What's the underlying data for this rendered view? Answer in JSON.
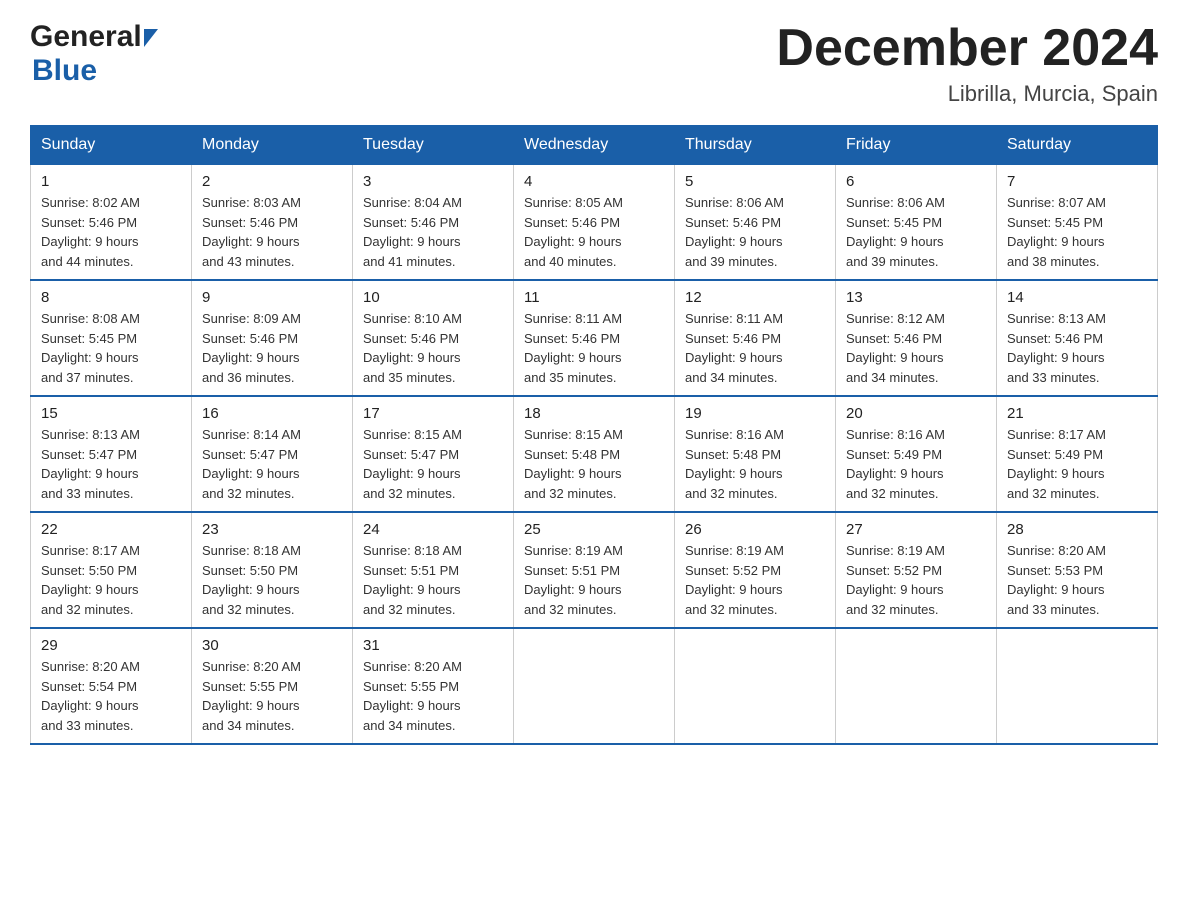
{
  "logo": {
    "general": "General",
    "blue": "Blue"
  },
  "title": "December 2024",
  "subtitle": "Librilla, Murcia, Spain",
  "days_of_week": [
    "Sunday",
    "Monday",
    "Tuesday",
    "Wednesday",
    "Thursday",
    "Friday",
    "Saturday"
  ],
  "weeks": [
    [
      {
        "day": "1",
        "sunrise": "8:02 AM",
        "sunset": "5:46 PM",
        "daylight": "9 hours and 44 minutes."
      },
      {
        "day": "2",
        "sunrise": "8:03 AM",
        "sunset": "5:46 PM",
        "daylight": "9 hours and 43 minutes."
      },
      {
        "day": "3",
        "sunrise": "8:04 AM",
        "sunset": "5:46 PM",
        "daylight": "9 hours and 41 minutes."
      },
      {
        "day": "4",
        "sunrise": "8:05 AM",
        "sunset": "5:46 PM",
        "daylight": "9 hours and 40 minutes."
      },
      {
        "day": "5",
        "sunrise": "8:06 AM",
        "sunset": "5:46 PM",
        "daylight": "9 hours and 39 minutes."
      },
      {
        "day": "6",
        "sunrise": "8:06 AM",
        "sunset": "5:45 PM",
        "daylight": "9 hours and 39 minutes."
      },
      {
        "day": "7",
        "sunrise": "8:07 AM",
        "sunset": "5:45 PM",
        "daylight": "9 hours and 38 minutes."
      }
    ],
    [
      {
        "day": "8",
        "sunrise": "8:08 AM",
        "sunset": "5:45 PM",
        "daylight": "9 hours and 37 minutes."
      },
      {
        "day": "9",
        "sunrise": "8:09 AM",
        "sunset": "5:46 PM",
        "daylight": "9 hours and 36 minutes."
      },
      {
        "day": "10",
        "sunrise": "8:10 AM",
        "sunset": "5:46 PM",
        "daylight": "9 hours and 35 minutes."
      },
      {
        "day": "11",
        "sunrise": "8:11 AM",
        "sunset": "5:46 PM",
        "daylight": "9 hours and 35 minutes."
      },
      {
        "day": "12",
        "sunrise": "8:11 AM",
        "sunset": "5:46 PM",
        "daylight": "9 hours and 34 minutes."
      },
      {
        "day": "13",
        "sunrise": "8:12 AM",
        "sunset": "5:46 PM",
        "daylight": "9 hours and 34 minutes."
      },
      {
        "day": "14",
        "sunrise": "8:13 AM",
        "sunset": "5:46 PM",
        "daylight": "9 hours and 33 minutes."
      }
    ],
    [
      {
        "day": "15",
        "sunrise": "8:13 AM",
        "sunset": "5:47 PM",
        "daylight": "9 hours and 33 minutes."
      },
      {
        "day": "16",
        "sunrise": "8:14 AM",
        "sunset": "5:47 PM",
        "daylight": "9 hours and 32 minutes."
      },
      {
        "day": "17",
        "sunrise": "8:15 AM",
        "sunset": "5:47 PM",
        "daylight": "9 hours and 32 minutes."
      },
      {
        "day": "18",
        "sunrise": "8:15 AM",
        "sunset": "5:48 PM",
        "daylight": "9 hours and 32 minutes."
      },
      {
        "day": "19",
        "sunrise": "8:16 AM",
        "sunset": "5:48 PM",
        "daylight": "9 hours and 32 minutes."
      },
      {
        "day": "20",
        "sunrise": "8:16 AM",
        "sunset": "5:49 PM",
        "daylight": "9 hours and 32 minutes."
      },
      {
        "day": "21",
        "sunrise": "8:17 AM",
        "sunset": "5:49 PM",
        "daylight": "9 hours and 32 minutes."
      }
    ],
    [
      {
        "day": "22",
        "sunrise": "8:17 AM",
        "sunset": "5:50 PM",
        "daylight": "9 hours and 32 minutes."
      },
      {
        "day": "23",
        "sunrise": "8:18 AM",
        "sunset": "5:50 PM",
        "daylight": "9 hours and 32 minutes."
      },
      {
        "day": "24",
        "sunrise": "8:18 AM",
        "sunset": "5:51 PM",
        "daylight": "9 hours and 32 minutes."
      },
      {
        "day": "25",
        "sunrise": "8:19 AM",
        "sunset": "5:51 PM",
        "daylight": "9 hours and 32 minutes."
      },
      {
        "day": "26",
        "sunrise": "8:19 AM",
        "sunset": "5:52 PM",
        "daylight": "9 hours and 32 minutes."
      },
      {
        "day": "27",
        "sunrise": "8:19 AM",
        "sunset": "5:52 PM",
        "daylight": "9 hours and 32 minutes."
      },
      {
        "day": "28",
        "sunrise": "8:20 AM",
        "sunset": "5:53 PM",
        "daylight": "9 hours and 33 minutes."
      }
    ],
    [
      {
        "day": "29",
        "sunrise": "8:20 AM",
        "sunset": "5:54 PM",
        "daylight": "9 hours and 33 minutes."
      },
      {
        "day": "30",
        "sunrise": "8:20 AM",
        "sunset": "5:55 PM",
        "daylight": "9 hours and 34 minutes."
      },
      {
        "day": "31",
        "sunrise": "8:20 AM",
        "sunset": "5:55 PM",
        "daylight": "9 hours and 34 minutes."
      },
      null,
      null,
      null,
      null
    ]
  ],
  "labels": {
    "sunrise": "Sunrise:",
    "sunset": "Sunset:",
    "daylight": "Daylight:"
  }
}
